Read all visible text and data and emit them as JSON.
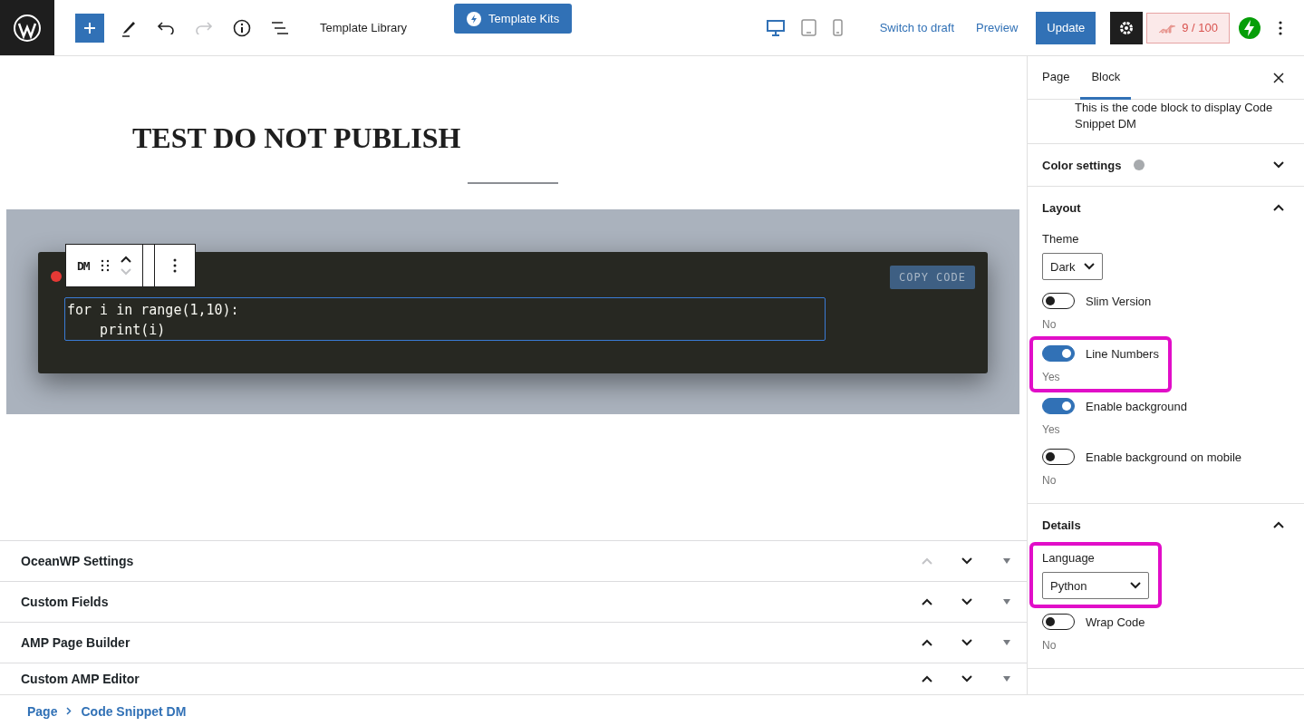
{
  "toolbar": {
    "template_library": "Template Library",
    "template_kits": "Template Kits",
    "devices": [
      {
        "kind": "desktop",
        "selected": true
      },
      {
        "kind": "tablet",
        "selected": false
      },
      {
        "kind": "mobile",
        "selected": false
      }
    ],
    "switch_to_draft": "Switch to draft",
    "preview": "Preview",
    "update": "Update",
    "score": "9 / 100"
  },
  "editor": {
    "title": "TEST DO NOT PUBLISH",
    "block_logo": "DM",
    "code_lines": [
      "for i in range(1,10):",
      "    print(i)"
    ],
    "copy_button": "COPY CODE"
  },
  "meta_boxes": [
    {
      "title": "OceanWP Settings",
      "up_disabled": true
    },
    {
      "title": "Custom Fields",
      "up_disabled": false
    },
    {
      "title": "AMP Page Builder",
      "up_disabled": false
    },
    {
      "title": "Custom AMP Editor",
      "up_disabled": false
    }
  ],
  "sidebar": {
    "tabs": [
      {
        "label": "Page",
        "selected": false
      },
      {
        "label": "Block",
        "selected": true
      }
    ],
    "description": "This is the code block to display Code Snippet DM",
    "panels": [
      {
        "title": "Color settings",
        "expanded": false,
        "color": "#a7aaad"
      },
      {
        "title": "Layout",
        "expanded": true,
        "controls": [
          {
            "kind": "select",
            "label": "Theme",
            "value": "Dark",
            "highlighted": false
          },
          {
            "kind": "toggle",
            "label": "Slim Version",
            "on": false,
            "help": "No",
            "highlighted": false
          },
          {
            "kind": "toggle",
            "label": "Line Numbers",
            "on": true,
            "help": "Yes",
            "highlighted": true
          },
          {
            "kind": "toggle",
            "label": "Enable background",
            "on": true,
            "help": "Yes",
            "highlighted": false
          },
          {
            "kind": "toggle",
            "label": "Enable background on mobile",
            "on": false,
            "help": "No",
            "highlighted": false
          }
        ]
      },
      {
        "title": "Details",
        "expanded": true,
        "controls": [
          {
            "kind": "select",
            "label": "Language",
            "value": "Python",
            "highlighted": true
          },
          {
            "kind": "toggle",
            "label": "Wrap Code",
            "on": false,
            "help": "No",
            "highlighted": false
          }
        ]
      }
    ]
  },
  "breadcrumb": [
    "Page",
    "Code Snippet DM"
  ]
}
